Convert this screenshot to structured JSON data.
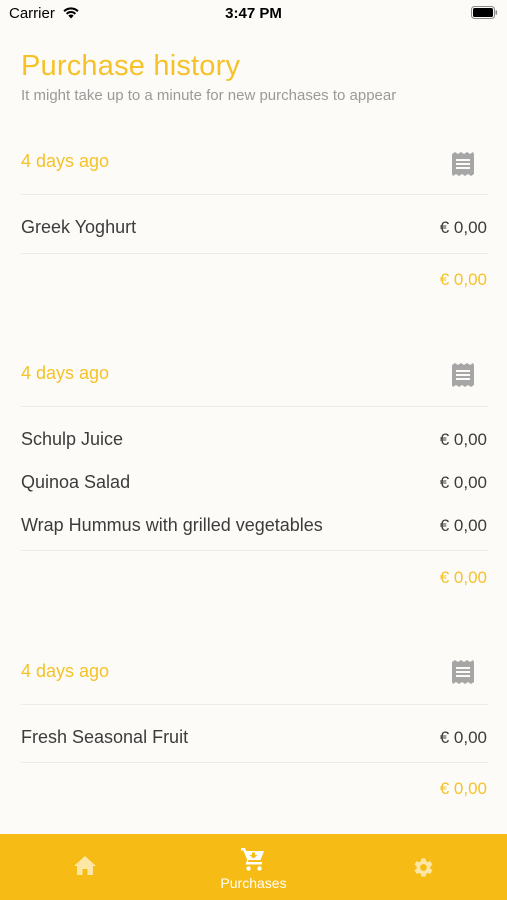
{
  "status_bar": {
    "carrier": "Carrier",
    "time": "3:47 PM"
  },
  "header": {
    "title": "Purchase history",
    "subtitle": "It might take up to a minute for new purchases to appear"
  },
  "groups": [
    {
      "date": "4 days ago",
      "items": [
        {
          "name": "Greek Yoghurt",
          "price": "€ 0,00"
        }
      ],
      "total": "€ 0,00"
    },
    {
      "date": "4 days ago",
      "items": [
        {
          "name": "Schulp Juice",
          "price": "€ 0,00"
        },
        {
          "name": "Quinoa Salad",
          "price": "€ 0,00"
        },
        {
          "name": "Wrap Hummus with grilled vegetables",
          "price": "€ 0,00"
        }
      ],
      "total": "€ 0,00"
    },
    {
      "date": "4 days ago",
      "items": [
        {
          "name": "Fresh Seasonal Fruit",
          "price": "€ 0,00"
        }
      ],
      "total": "€ 0,00"
    }
  ],
  "tab_bar": {
    "tabs": [
      {
        "icon": "home-icon",
        "label": ""
      },
      {
        "icon": "cart-icon",
        "label": "Purchases",
        "selected": true
      },
      {
        "icon": "gear-icon",
        "label": ""
      }
    ]
  },
  "colors": {
    "accent": "#f5c229",
    "tab_bar": "#f6bb15",
    "background": "#fcfbf7",
    "text": "#3c3c3c",
    "receipt_icon": "#a6a6a6"
  }
}
